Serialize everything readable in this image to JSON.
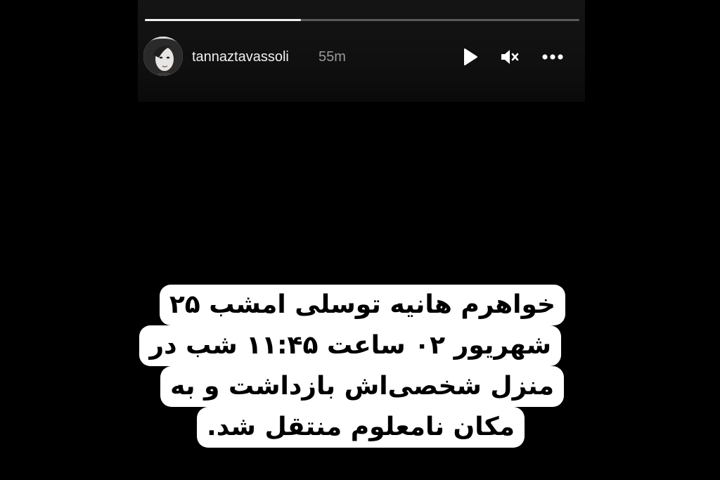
{
  "story": {
    "progress": 0.36,
    "username": "tannaztavassoli",
    "timestamp": "55m",
    "controls": {
      "play_icon": "play-icon",
      "mute_icon": "muted-speaker-icon",
      "more_icon": "more-options-icon"
    },
    "caption_lines": [
      "خواهرم هانیه توسلی امشب ۲۵",
      "شهریور ۰۲ ساعت ۱۱:۴۵ شب در",
      "منزل شخصی‌اش بازداشت و به",
      "مکان نامعلوم منتقل شد."
    ]
  },
  "colors": {
    "background": "#000000",
    "caption_bg": "#ffffff",
    "caption_text": "#000000",
    "timestamp": "#9a9a9a"
  }
}
